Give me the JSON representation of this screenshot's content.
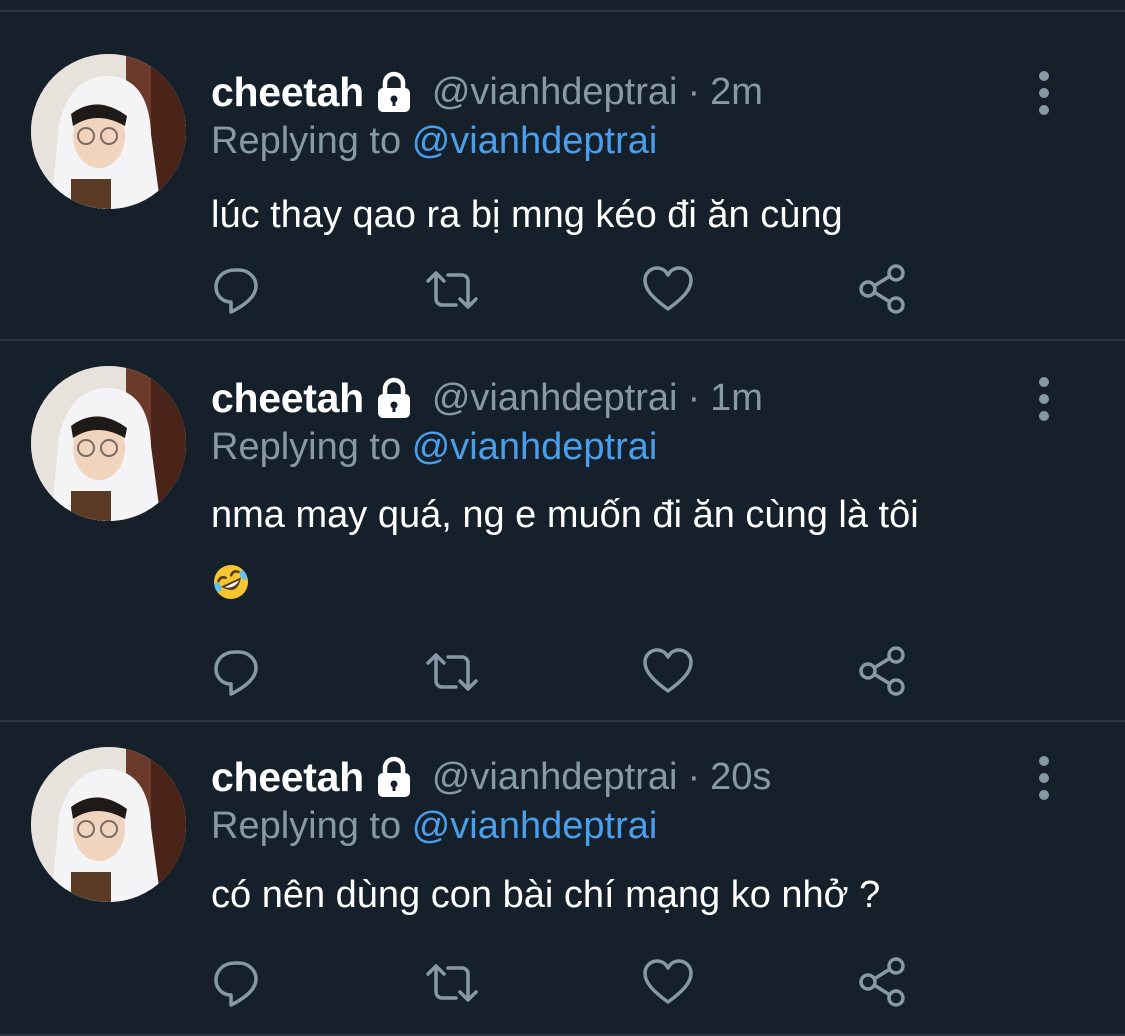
{
  "tweets": [
    {
      "name": "cheetah",
      "handle": "@vianhdeptrai",
      "separator": "·",
      "time": "2m",
      "replying_prefix": "Replying to",
      "replying_handle": "@vianhdeptrai",
      "text": "lúc thay qao ra bị mng kéo đi ăn cùng",
      "emoji": ""
    },
    {
      "name": "cheetah",
      "handle": "@vianhdeptrai",
      "separator": "·",
      "time": "1m",
      "replying_prefix": "Replying to",
      "replying_handle": "@vianhdeptrai",
      "text": "nma may quá, ng e muốn đi ăn cùng là tôi",
      "emoji": "rolling-on-floor-laughing"
    },
    {
      "name": "cheetah",
      "handle": "@vianhdeptrai",
      "separator": "·",
      "time": "20s",
      "replying_prefix": "Replying to",
      "replying_handle": "@vianhdeptrai",
      "text": "có nên dùng con bài chí mạng ko nhở ?",
      "emoji": ""
    }
  ],
  "icons": {
    "lock": "lock-icon",
    "more": "more-vertical-icon",
    "reply": "comment-icon",
    "retweet": "retweet-icon",
    "like": "heart-icon",
    "share": "share-icon"
  },
  "colors": {
    "background": "#15202b",
    "divider": "#2c3640",
    "secondary_text": "#8899a6",
    "link": "#4a9eea",
    "primary_text": "#ffffff"
  }
}
